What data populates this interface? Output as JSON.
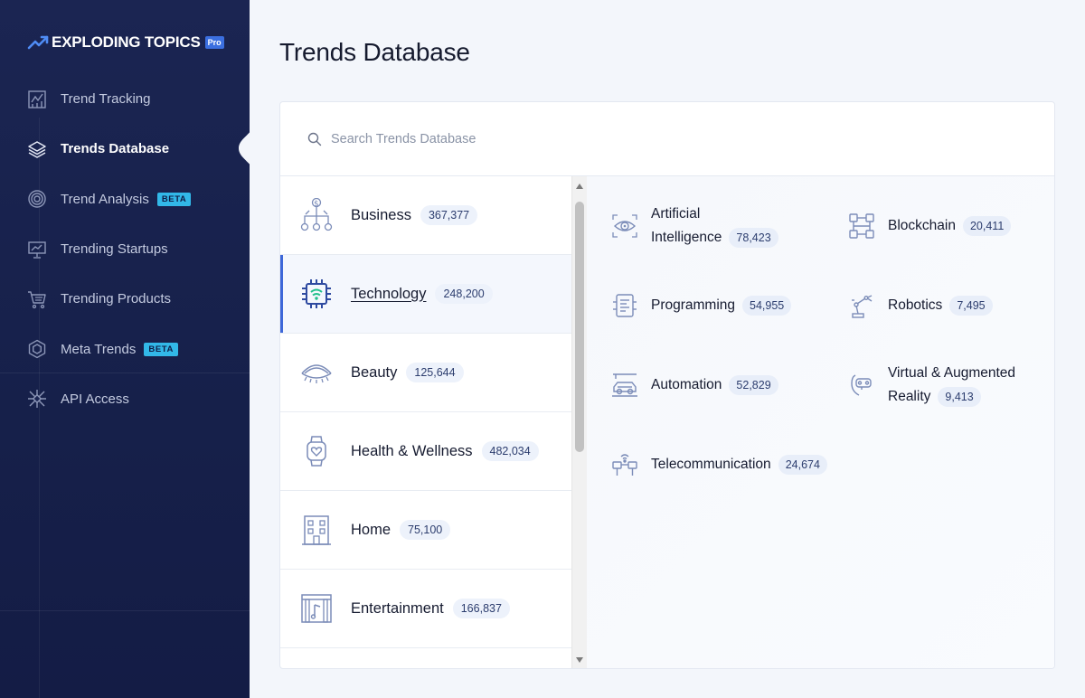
{
  "brand": {
    "name": "EXPLODING TOPICS",
    "tier_badge": "Pro",
    "accent_color": "#3b6fe0"
  },
  "sidebar": {
    "items": [
      {
        "label": "Trend Tracking",
        "icon": "chart-icon"
      },
      {
        "label": "Trends Database",
        "icon": "layers-icon",
        "active": true
      },
      {
        "label": "Trend Analysis",
        "icon": "target-icon",
        "badge": "BETA"
      },
      {
        "label": "Trending Startups",
        "icon": "presentation-icon"
      },
      {
        "label": "Trending Products",
        "icon": "cart-icon"
      },
      {
        "label": "Meta Trends",
        "icon": "hexagon-icon",
        "badge": "BETA"
      },
      {
        "label": "API Access",
        "icon": "network-icon"
      }
    ]
  },
  "main": {
    "title": "Trends Database",
    "search": {
      "placeholder": "Search Trends Database",
      "value": ""
    }
  },
  "categories": [
    {
      "label": "Business",
      "count": "367,377",
      "icon": "money-tree-icon"
    },
    {
      "label": "Technology",
      "count": "248,200",
      "icon": "chip-icon",
      "active": true
    },
    {
      "label": "Beauty",
      "count": "125,644",
      "icon": "eyelash-icon"
    },
    {
      "label": "Health & Wellness",
      "count": "482,034",
      "icon": "smartwatch-heart-icon"
    },
    {
      "label": "Home",
      "count": "75,100",
      "icon": "building-icon"
    },
    {
      "label": "Entertainment",
      "count": "166,837",
      "icon": "stage-music-icon"
    }
  ],
  "subcategories": [
    {
      "line1": "Artificial",
      "line2": "Intelligence",
      "count": "78,423",
      "icon": "ai-eye-icon"
    },
    {
      "line1": "Blockchain",
      "count": "20,411",
      "icon": "blockchain-icon"
    },
    {
      "line1": "Programming",
      "count": "54,955",
      "icon": "code-doc-icon"
    },
    {
      "line1": "Robotics",
      "count": "7,495",
      "icon": "robot-arm-icon"
    },
    {
      "line1": "Automation",
      "count": "52,829",
      "icon": "autonomous-car-icon"
    },
    {
      "line1": "Virtual & Augmented",
      "line2": "Reality",
      "count": "9,413",
      "icon": "vr-headset-icon"
    },
    {
      "line1": "Telecommunication",
      "count": "24,674",
      "icon": "telecom-icon"
    }
  ]
}
